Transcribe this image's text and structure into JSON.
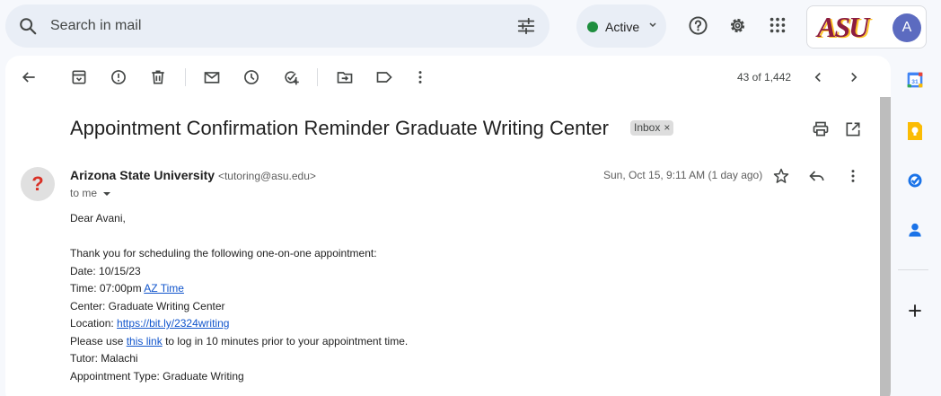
{
  "search": {
    "placeholder": "Search in mail",
    "icon": "search-icon",
    "filter_icon": "tune-icon"
  },
  "status": {
    "label": "Active",
    "color": "#1e8e3e"
  },
  "header_icons": [
    "help-icon",
    "settings-icon",
    "apps-icon"
  ],
  "account": {
    "logo_text": "ASU",
    "avatar_initial": "A",
    "brand_color": "#8c1d40",
    "avatar_color": "#5c6bc0"
  },
  "toolbar": {
    "icons": [
      "back-icon",
      "archive-icon",
      "report-spam-icon",
      "delete-icon",
      "mark-unread-icon",
      "snooze-icon",
      "add-task-icon",
      "move-to-icon",
      "label-icon",
      "more-icon"
    ],
    "pager": "43 of 1,442"
  },
  "email": {
    "subject": "Appointment Confirmation Reminder Graduate Writing Center",
    "label": "Inbox",
    "label_close": "×",
    "sender_avatar": "?",
    "sender_name": "Arizona State University",
    "sender_email": "<tutoring@asu.edu>",
    "to": "to me",
    "date": "Sun, Oct 15, 9:11 AM (1 day ago)",
    "body": {
      "greeting": "Dear Avani,",
      "intro": "Thank you for scheduling the following one-on-one appointment:",
      "date_line": "Date: 10/15/23",
      "time_prefix": "Time: 07:00pm ",
      "time_link": "AZ Time",
      "center": "Center: Graduate Writing Center",
      "location_prefix": "Location: ",
      "location_link": "https://bit.ly/2324writing",
      "login_prefix": "Please use ",
      "login_link": "this link",
      "login_suffix": " to log in 10 minutes prior to your appointment time.",
      "tutor": "Tutor: Malachi",
      "type": "Appointment Type: Graduate Writing"
    }
  },
  "side_panel": [
    "calendar-icon",
    "keep-icon",
    "tasks-icon",
    "contacts-icon",
    "add-icon"
  ]
}
